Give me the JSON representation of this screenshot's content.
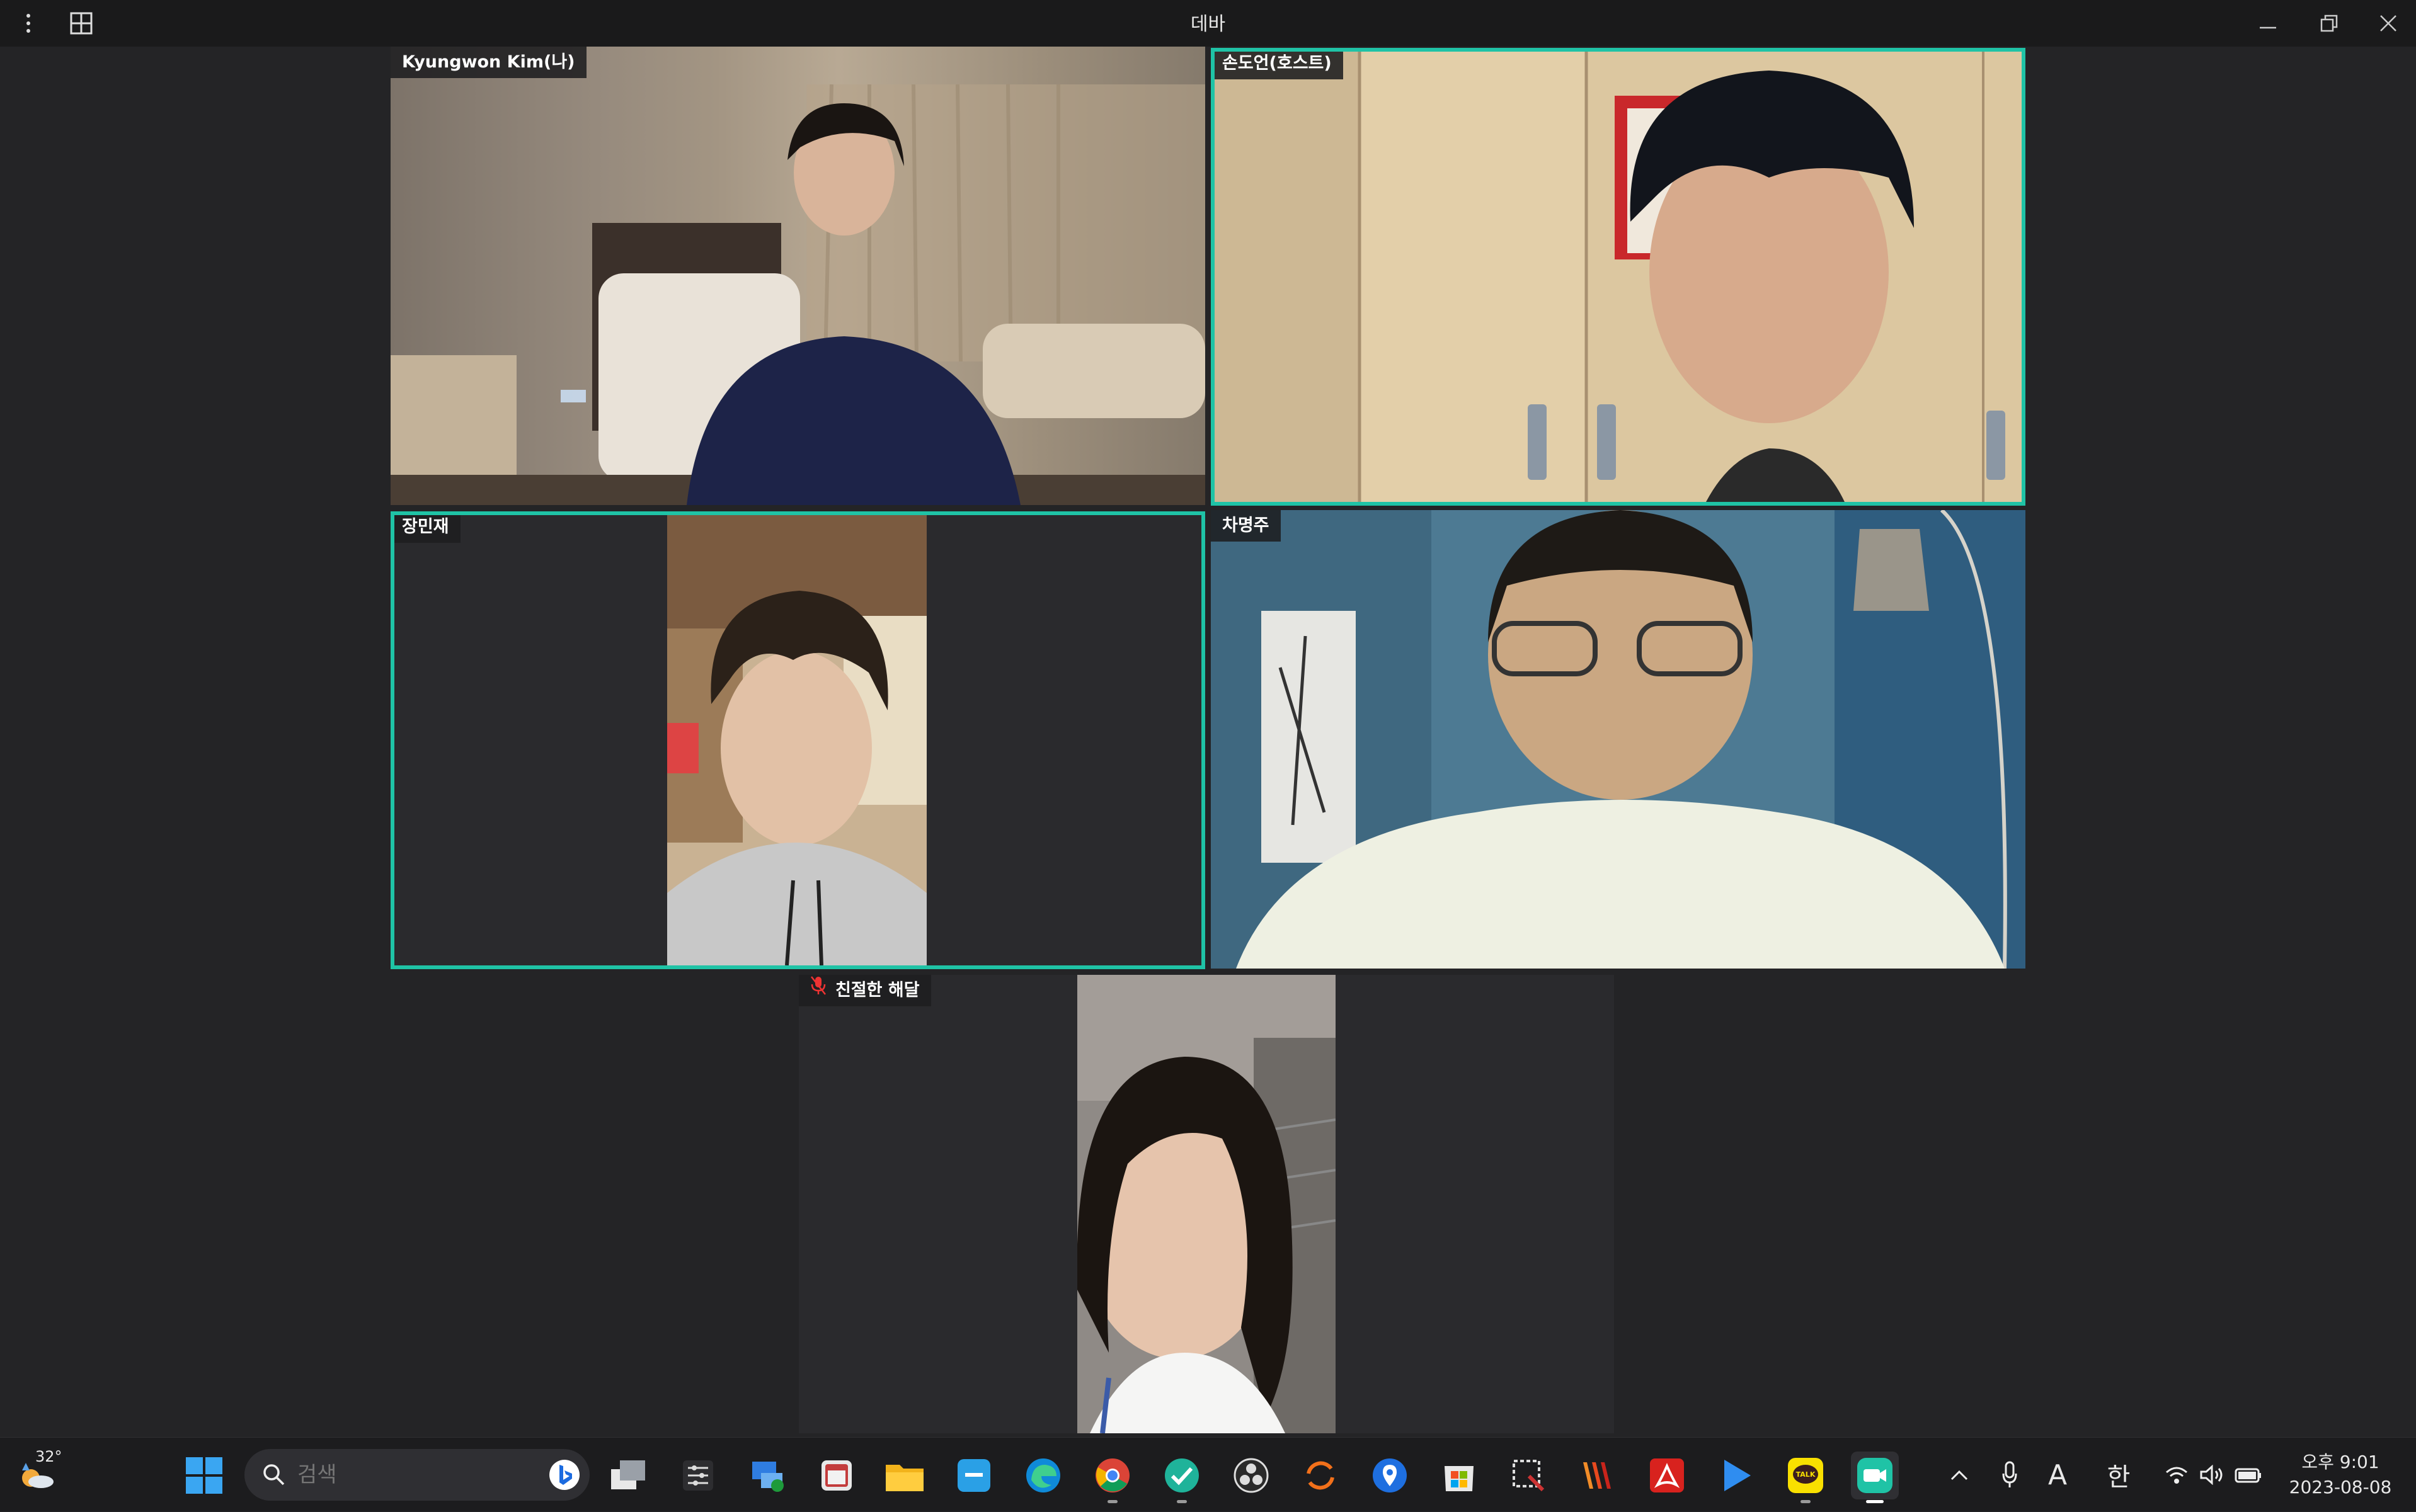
{
  "window": {
    "title": "데바"
  },
  "participants": [
    {
      "name": "Kyungwon Kim(나)",
      "active": false,
      "muted": false
    },
    {
      "name": "손도언(호스트)",
      "active": true,
      "muted": false
    },
    {
      "name": "장민재",
      "active": true,
      "muted": false
    },
    {
      "name": "차명주",
      "active": false,
      "muted": false
    },
    {
      "name": "친절한 해달",
      "active": false,
      "muted": true
    }
  ],
  "taskbar": {
    "weather": {
      "temp": "32°"
    },
    "search": {
      "placeholder": "검색"
    },
    "apps": [
      "windows-start",
      "task-view",
      "settings",
      "remote-desktop",
      "snipping",
      "file-explorer",
      "onenote",
      "edge",
      "chrome",
      "vpn",
      "obs",
      "sync",
      "maps",
      "store",
      "mobile-devices",
      "winamp",
      "acrobat",
      "play",
      "kakaotalk",
      "zoom"
    ],
    "tray": {
      "ime": "A",
      "hangul": "한"
    },
    "clock": {
      "time": "오후 9:01",
      "date": "2023-08-08"
    }
  },
  "colors": {
    "active_border": "#1fc3a6",
    "background": "#242426",
    "taskbar": "#1c1c1e"
  }
}
